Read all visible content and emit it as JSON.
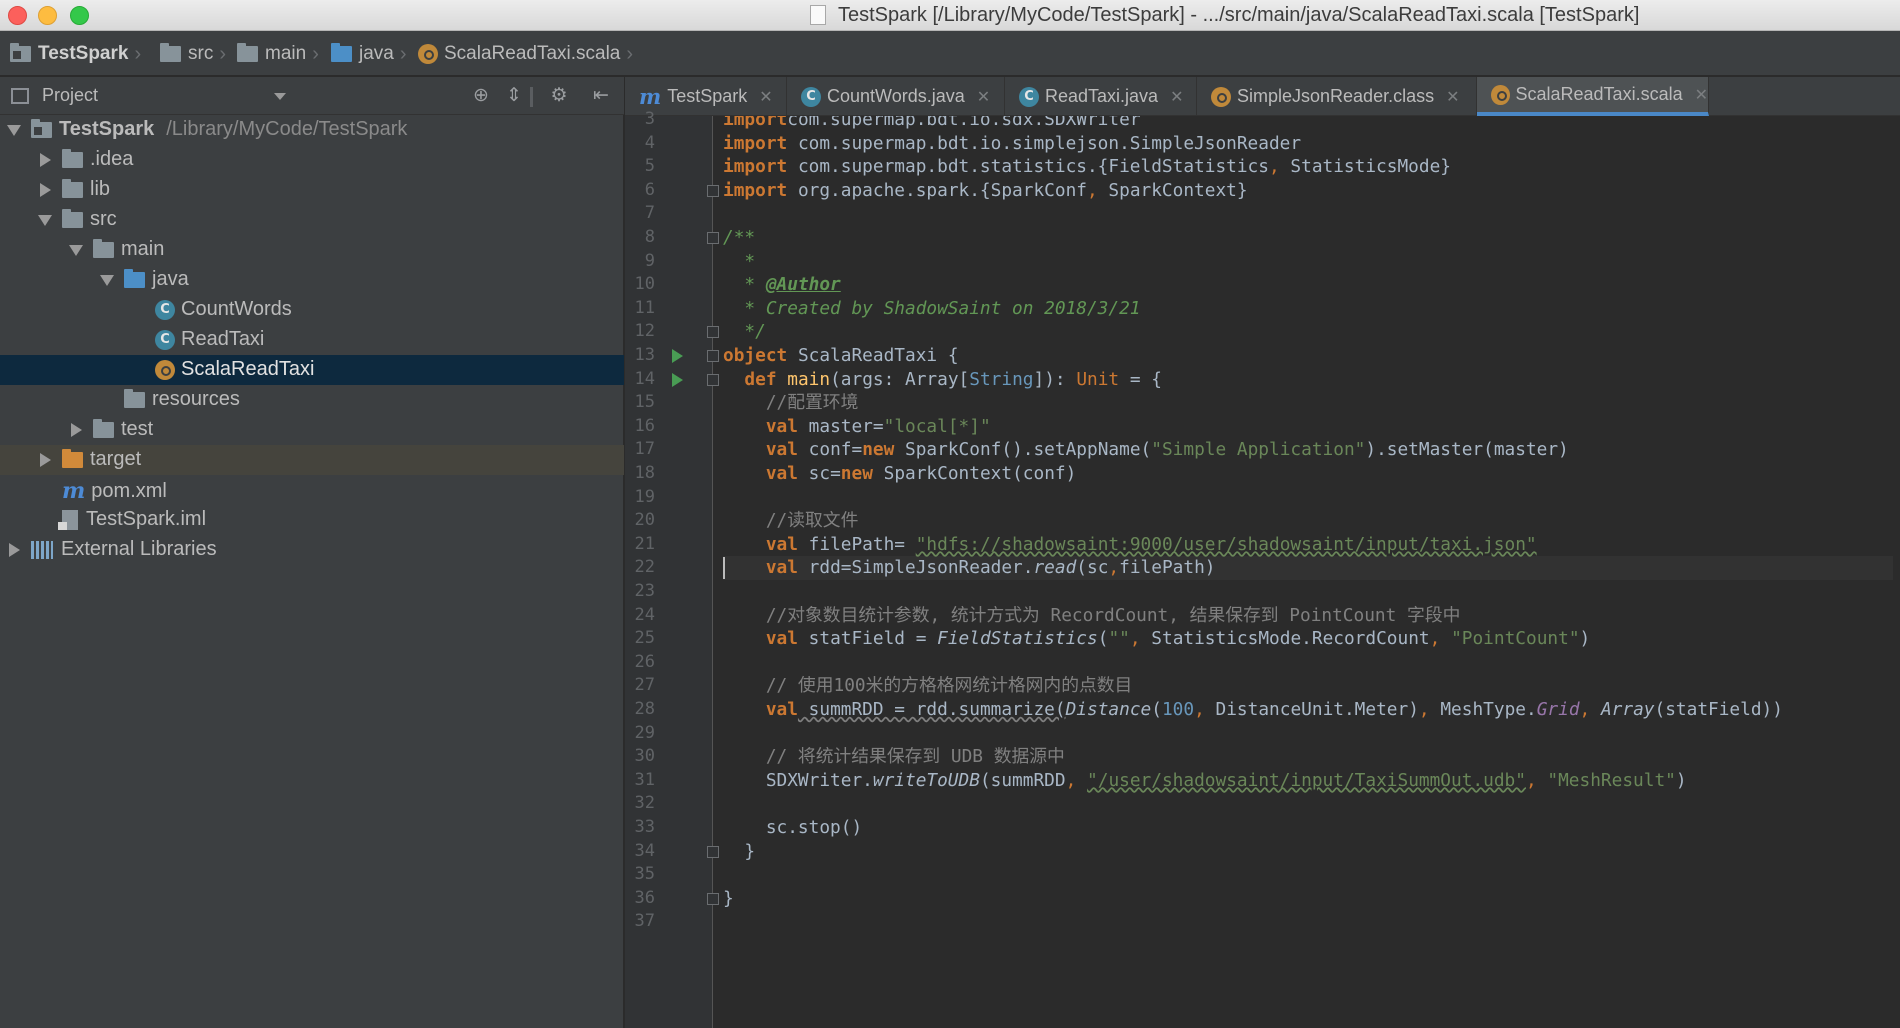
{
  "window": {
    "title": "TestSpark [/Library/MyCode/TestSpark] - .../src/main/java/ScalaReadTaxi.scala [TestSpark]"
  },
  "breadcrumb": [
    {
      "label": "TestSpark",
      "icon": "project-folder-icon"
    },
    {
      "label": "src",
      "icon": "folder-icon"
    },
    {
      "label": "main",
      "icon": "folder-icon"
    },
    {
      "label": "java",
      "icon": "folder-blue-icon"
    },
    {
      "label": "ScalaReadTaxi.scala",
      "icon": "scala-object-icon"
    }
  ],
  "project_panel": {
    "title": "Project",
    "tree": [
      {
        "label": "TestSpark",
        "path": "/Library/MyCode/TestSpark",
        "depth": 0,
        "expanded": true,
        "icon": "project-folder-icon"
      },
      {
        "label": ".idea",
        "depth": 1,
        "expanded": false,
        "icon": "folder-icon"
      },
      {
        "label": "lib",
        "depth": 1,
        "expanded": false,
        "icon": "folder-icon"
      },
      {
        "label": "src",
        "depth": 1,
        "expanded": true,
        "icon": "folder-icon"
      },
      {
        "label": "main",
        "depth": 2,
        "expanded": true,
        "icon": "folder-icon"
      },
      {
        "label": "java",
        "depth": 3,
        "expanded": true,
        "icon": "folder-blue-icon"
      },
      {
        "label": "CountWords",
        "depth": 4,
        "icon": "java-class-icon"
      },
      {
        "label": "ReadTaxi",
        "depth": 4,
        "icon": "java-class-icon"
      },
      {
        "label": "ScalaReadTaxi",
        "depth": 4,
        "icon": "scala-object-icon",
        "selected": true
      },
      {
        "label": "resources",
        "depth": 3,
        "icon": "resources-folder-icon"
      },
      {
        "label": "test",
        "depth": 2,
        "expanded": false,
        "icon": "folder-icon"
      },
      {
        "label": "target",
        "depth": 1,
        "expanded": false,
        "icon": "folder-orange-icon"
      },
      {
        "label": "pom.xml",
        "depth": 1,
        "icon": "maven-icon"
      },
      {
        "label": "TestSpark.iml",
        "depth": 1,
        "icon": "iml-file-icon"
      },
      {
        "label": "External Libraries",
        "depth": 0,
        "expanded": false,
        "icon": "libraries-icon"
      }
    ]
  },
  "tabs": [
    {
      "label": "TestSpark",
      "icon": "maven-icon",
      "active": false
    },
    {
      "label": "CountWords.java",
      "icon": "java-class-icon",
      "active": false
    },
    {
      "label": "ReadTaxi.java",
      "icon": "java-class-icon",
      "active": false
    },
    {
      "label": "SimpleJsonReader.class",
      "icon": "scala-object-icon",
      "active": false
    },
    {
      "label": "ScalaReadTaxi.scala",
      "icon": "scala-object-icon",
      "active": true
    }
  ],
  "editor": {
    "current_line": 22,
    "line_numbers": [
      "3",
      "4",
      "5",
      "6",
      "7",
      "8",
      "9",
      "10",
      "11",
      "12",
      "13",
      "14",
      "15",
      "16",
      "17",
      "18",
      "19",
      "20",
      "21",
      "22",
      "23",
      "24",
      "25",
      "26",
      "27",
      "28",
      "29",
      "30",
      "31",
      "32",
      "33",
      "34",
      "35",
      "36",
      "37"
    ],
    "run_markers": [
      "13",
      "14"
    ],
    "fold_markers": [
      "6",
      "8",
      "12",
      "13",
      "14",
      "34",
      "36"
    ],
    "code": [
      [
        [
          "kw",
          "import"
        ],
        [
          "",
          "com.supermap.bdt.io.sdx.SDXWriter"
        ]
      ],
      [
        [
          "kw",
          "import"
        ],
        [
          "",
          " com.supermap.bdt.io.simplejson.SimpleJsonReader"
        ]
      ],
      [
        [
          "kw",
          "import"
        ],
        [
          "",
          " com.supermap.bdt.statistics.{FieldStatistics"
        ],
        [
          "kwn",
          ","
        ],
        [
          "",
          " StatisticsMode}"
        ]
      ],
      [
        [
          "kw",
          "import"
        ],
        [
          "",
          " org.apache.spark.{SparkConf"
        ],
        [
          "kwn",
          ","
        ],
        [
          "",
          " SparkContext}"
        ]
      ],
      [],
      [
        [
          "doc",
          "/**"
        ]
      ],
      [
        [
          "doc",
          "  *"
        ]
      ],
      [
        [
          "doc",
          "  * "
        ],
        [
          "tag",
          "@Author"
        ]
      ],
      [
        [
          "doc",
          "  * Created by ShadowSaint on 2018/3/21"
        ]
      ],
      [
        [
          "doc",
          "  */"
        ]
      ],
      [
        [
          "kw",
          "object"
        ],
        [
          "",
          " ScalaReadTaxi {"
        ]
      ],
      [
        [
          "",
          "  "
        ],
        [
          "kw",
          "def"
        ],
        [
          "fn",
          " main"
        ],
        [
          "",
          "(args: Array["
        ],
        [
          "ty",
          "String"
        ],
        [
          "",
          "]): "
        ],
        [
          "kwn",
          "Unit"
        ],
        [
          "",
          " = {"
        ]
      ],
      [
        [
          "cmt",
          "    //配置环境"
        ]
      ],
      [
        [
          "",
          "    "
        ],
        [
          "kw",
          "val"
        ],
        [
          "",
          " master="
        ],
        [
          "str",
          "\"local[*]\""
        ]
      ],
      [
        [
          "",
          "    "
        ],
        [
          "kw",
          "val"
        ],
        [
          "",
          " conf="
        ],
        [
          "kw",
          "new"
        ],
        [
          "",
          " SparkConf().setAppName("
        ],
        [
          "str",
          "\"Simple Application\""
        ],
        [
          "",
          ").setMaster(master)"
        ]
      ],
      [
        [
          "",
          "    "
        ],
        [
          "kw",
          "val"
        ],
        [
          "",
          " sc="
        ],
        [
          "kw",
          "new"
        ],
        [
          "",
          " SparkContext(conf)"
        ]
      ],
      [],
      [
        [
          "cmt",
          "    //读取文件"
        ]
      ],
      [
        [
          "",
          "    "
        ],
        [
          "kw",
          "val"
        ],
        [
          "",
          " filePath= "
        ],
        [
          "str",
          "\"hdfs://shadowsaint:9000/user/shadowsaint/input/taxi.json\""
        ]
      ],
      [
        [
          "",
          "    "
        ],
        [
          "kw",
          "val"
        ],
        [
          "",
          " rdd=SimpleJsonReader."
        ],
        [
          "it",
          "read"
        ],
        [
          "",
          "(sc"
        ],
        [
          "kwn",
          ","
        ],
        [
          "",
          "filePath)"
        ]
      ],
      [],
      [
        [
          "cmt",
          "    //对象数目统计参数, 统计方式为 RecordCount, 结果保存到 PointCount 字段中"
        ]
      ],
      [
        [
          "",
          "    "
        ],
        [
          "kw",
          "val"
        ],
        [
          "",
          " statField = "
        ],
        [
          "it",
          "FieldStatistics"
        ],
        [
          "",
          "("
        ],
        [
          "str",
          "\"\""
        ],
        [
          "kwn",
          ","
        ],
        [
          "",
          " StatisticsMode.RecordCount"
        ],
        [
          "kwn",
          ","
        ],
        [
          "",
          " "
        ],
        [
          "str",
          "\"PointCount\""
        ],
        [
          "",
          ")"
        ]
      ],
      [],
      [
        [
          "cmt",
          "    // 使用100米的方格格网统计格网内的点数目"
        ]
      ],
      [
        [
          "",
          "    "
        ],
        [
          "kw",
          "val"
        ],
        [
          "",
          " summRDD = rdd.summarize("
        ],
        [
          "it",
          "Distance"
        ],
        [
          "",
          "("
        ],
        [
          "num",
          "100"
        ],
        [
          "kwn",
          ","
        ],
        [
          "",
          " DistanceUnit.Meter)"
        ],
        [
          "kwn",
          ","
        ],
        [
          "",
          " MeshType."
        ],
        [
          "purple",
          "Grid"
        ],
        [
          "kwn",
          ","
        ],
        [
          "",
          " "
        ],
        [
          "it",
          "Array"
        ],
        [
          "",
          "(statField))"
        ]
      ],
      [],
      [
        [
          "cmt",
          "    // 将统计结果保存到 UDB 数据源中"
        ]
      ],
      [
        [
          "",
          "    SDXWriter."
        ],
        [
          "it",
          "writeToUDB"
        ],
        [
          "",
          "(summRDD"
        ],
        [
          "kwn",
          ","
        ],
        [
          "",
          " "
        ],
        [
          "str",
          "\"/user/shadowsaint/input/TaxiSummOut.udb\""
        ],
        [
          "kwn",
          ","
        ],
        [
          "",
          " "
        ],
        [
          "str",
          "\"MeshResult\""
        ],
        [
          "",
          ")"
        ]
      ],
      [],
      [
        [
          "",
          "    sc.stop()"
        ]
      ],
      [
        [
          "",
          "  }"
        ]
      ],
      [],
      [
        [
          "",
          "}"
        ]
      ],
      []
    ]
  },
  "colors": {
    "keyword": "#cc7832",
    "string": "#6a8759",
    "comment": "#808080",
    "doc_comment": "#629755",
    "number": "#6897bb",
    "function": "#ffc66d",
    "selection": "#0d293e",
    "active_tab_underline": "#4a88c7"
  }
}
